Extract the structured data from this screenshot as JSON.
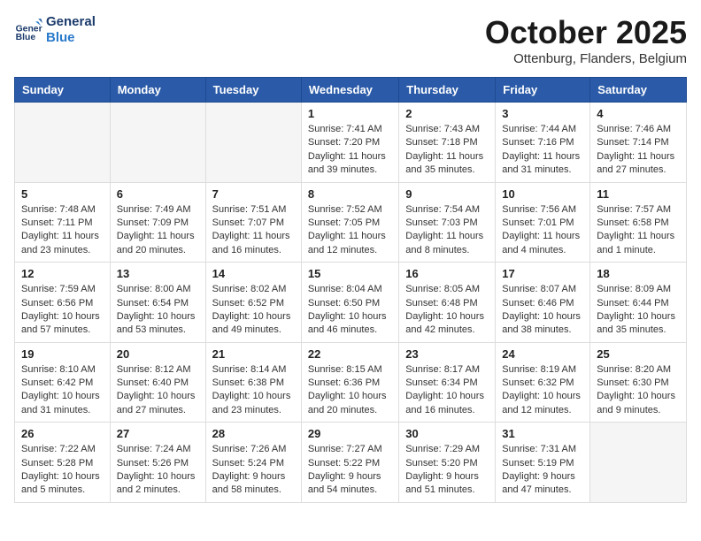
{
  "header": {
    "logo_line1": "General",
    "logo_line2": "Blue",
    "month": "October 2025",
    "location": "Ottenburg, Flanders, Belgium"
  },
  "weekdays": [
    "Sunday",
    "Monday",
    "Tuesday",
    "Wednesday",
    "Thursday",
    "Friday",
    "Saturday"
  ],
  "weeks": [
    [
      {
        "day": "",
        "sunrise": "",
        "sunset": "",
        "daylight": ""
      },
      {
        "day": "",
        "sunrise": "",
        "sunset": "",
        "daylight": ""
      },
      {
        "day": "",
        "sunrise": "",
        "sunset": "",
        "daylight": ""
      },
      {
        "day": "1",
        "sunrise": "Sunrise: 7:41 AM",
        "sunset": "Sunset: 7:20 PM",
        "daylight": "Daylight: 11 hours and 39 minutes."
      },
      {
        "day": "2",
        "sunrise": "Sunrise: 7:43 AM",
        "sunset": "Sunset: 7:18 PM",
        "daylight": "Daylight: 11 hours and 35 minutes."
      },
      {
        "day": "3",
        "sunrise": "Sunrise: 7:44 AM",
        "sunset": "Sunset: 7:16 PM",
        "daylight": "Daylight: 11 hours and 31 minutes."
      },
      {
        "day": "4",
        "sunrise": "Sunrise: 7:46 AM",
        "sunset": "Sunset: 7:14 PM",
        "daylight": "Daylight: 11 hours and 27 minutes."
      }
    ],
    [
      {
        "day": "5",
        "sunrise": "Sunrise: 7:48 AM",
        "sunset": "Sunset: 7:11 PM",
        "daylight": "Daylight: 11 hours and 23 minutes."
      },
      {
        "day": "6",
        "sunrise": "Sunrise: 7:49 AM",
        "sunset": "Sunset: 7:09 PM",
        "daylight": "Daylight: 11 hours and 20 minutes."
      },
      {
        "day": "7",
        "sunrise": "Sunrise: 7:51 AM",
        "sunset": "Sunset: 7:07 PM",
        "daylight": "Daylight: 11 hours and 16 minutes."
      },
      {
        "day": "8",
        "sunrise": "Sunrise: 7:52 AM",
        "sunset": "Sunset: 7:05 PM",
        "daylight": "Daylight: 11 hours and 12 minutes."
      },
      {
        "day": "9",
        "sunrise": "Sunrise: 7:54 AM",
        "sunset": "Sunset: 7:03 PM",
        "daylight": "Daylight: 11 hours and 8 minutes."
      },
      {
        "day": "10",
        "sunrise": "Sunrise: 7:56 AM",
        "sunset": "Sunset: 7:01 PM",
        "daylight": "Daylight: 11 hours and 4 minutes."
      },
      {
        "day": "11",
        "sunrise": "Sunrise: 7:57 AM",
        "sunset": "Sunset: 6:58 PM",
        "daylight": "Daylight: 11 hours and 1 minute."
      }
    ],
    [
      {
        "day": "12",
        "sunrise": "Sunrise: 7:59 AM",
        "sunset": "Sunset: 6:56 PM",
        "daylight": "Daylight: 10 hours and 57 minutes."
      },
      {
        "day": "13",
        "sunrise": "Sunrise: 8:00 AM",
        "sunset": "Sunset: 6:54 PM",
        "daylight": "Daylight: 10 hours and 53 minutes."
      },
      {
        "day": "14",
        "sunrise": "Sunrise: 8:02 AM",
        "sunset": "Sunset: 6:52 PM",
        "daylight": "Daylight: 10 hours and 49 minutes."
      },
      {
        "day": "15",
        "sunrise": "Sunrise: 8:04 AM",
        "sunset": "Sunset: 6:50 PM",
        "daylight": "Daylight: 10 hours and 46 minutes."
      },
      {
        "day": "16",
        "sunrise": "Sunrise: 8:05 AM",
        "sunset": "Sunset: 6:48 PM",
        "daylight": "Daylight: 10 hours and 42 minutes."
      },
      {
        "day": "17",
        "sunrise": "Sunrise: 8:07 AM",
        "sunset": "Sunset: 6:46 PM",
        "daylight": "Daylight: 10 hours and 38 minutes."
      },
      {
        "day": "18",
        "sunrise": "Sunrise: 8:09 AM",
        "sunset": "Sunset: 6:44 PM",
        "daylight": "Daylight: 10 hours and 35 minutes."
      }
    ],
    [
      {
        "day": "19",
        "sunrise": "Sunrise: 8:10 AM",
        "sunset": "Sunset: 6:42 PM",
        "daylight": "Daylight: 10 hours and 31 minutes."
      },
      {
        "day": "20",
        "sunrise": "Sunrise: 8:12 AM",
        "sunset": "Sunset: 6:40 PM",
        "daylight": "Daylight: 10 hours and 27 minutes."
      },
      {
        "day": "21",
        "sunrise": "Sunrise: 8:14 AM",
        "sunset": "Sunset: 6:38 PM",
        "daylight": "Daylight: 10 hours and 23 minutes."
      },
      {
        "day": "22",
        "sunrise": "Sunrise: 8:15 AM",
        "sunset": "Sunset: 6:36 PM",
        "daylight": "Daylight: 10 hours and 20 minutes."
      },
      {
        "day": "23",
        "sunrise": "Sunrise: 8:17 AM",
        "sunset": "Sunset: 6:34 PM",
        "daylight": "Daylight: 10 hours and 16 minutes."
      },
      {
        "day": "24",
        "sunrise": "Sunrise: 8:19 AM",
        "sunset": "Sunset: 6:32 PM",
        "daylight": "Daylight: 10 hours and 12 minutes."
      },
      {
        "day": "25",
        "sunrise": "Sunrise: 8:20 AM",
        "sunset": "Sunset: 6:30 PM",
        "daylight": "Daylight: 10 hours and 9 minutes."
      }
    ],
    [
      {
        "day": "26",
        "sunrise": "Sunrise: 7:22 AM",
        "sunset": "Sunset: 5:28 PM",
        "daylight": "Daylight: 10 hours and 5 minutes."
      },
      {
        "day": "27",
        "sunrise": "Sunrise: 7:24 AM",
        "sunset": "Sunset: 5:26 PM",
        "daylight": "Daylight: 10 hours and 2 minutes."
      },
      {
        "day": "28",
        "sunrise": "Sunrise: 7:26 AM",
        "sunset": "Sunset: 5:24 PM",
        "daylight": "Daylight: 9 hours and 58 minutes."
      },
      {
        "day": "29",
        "sunrise": "Sunrise: 7:27 AM",
        "sunset": "Sunset: 5:22 PM",
        "daylight": "Daylight: 9 hours and 54 minutes."
      },
      {
        "day": "30",
        "sunrise": "Sunrise: 7:29 AM",
        "sunset": "Sunset: 5:20 PM",
        "daylight": "Daylight: 9 hours and 51 minutes."
      },
      {
        "day": "31",
        "sunrise": "Sunrise: 7:31 AM",
        "sunset": "Sunset: 5:19 PM",
        "daylight": "Daylight: 9 hours and 47 minutes."
      },
      {
        "day": "",
        "sunrise": "",
        "sunset": "",
        "daylight": ""
      }
    ]
  ]
}
